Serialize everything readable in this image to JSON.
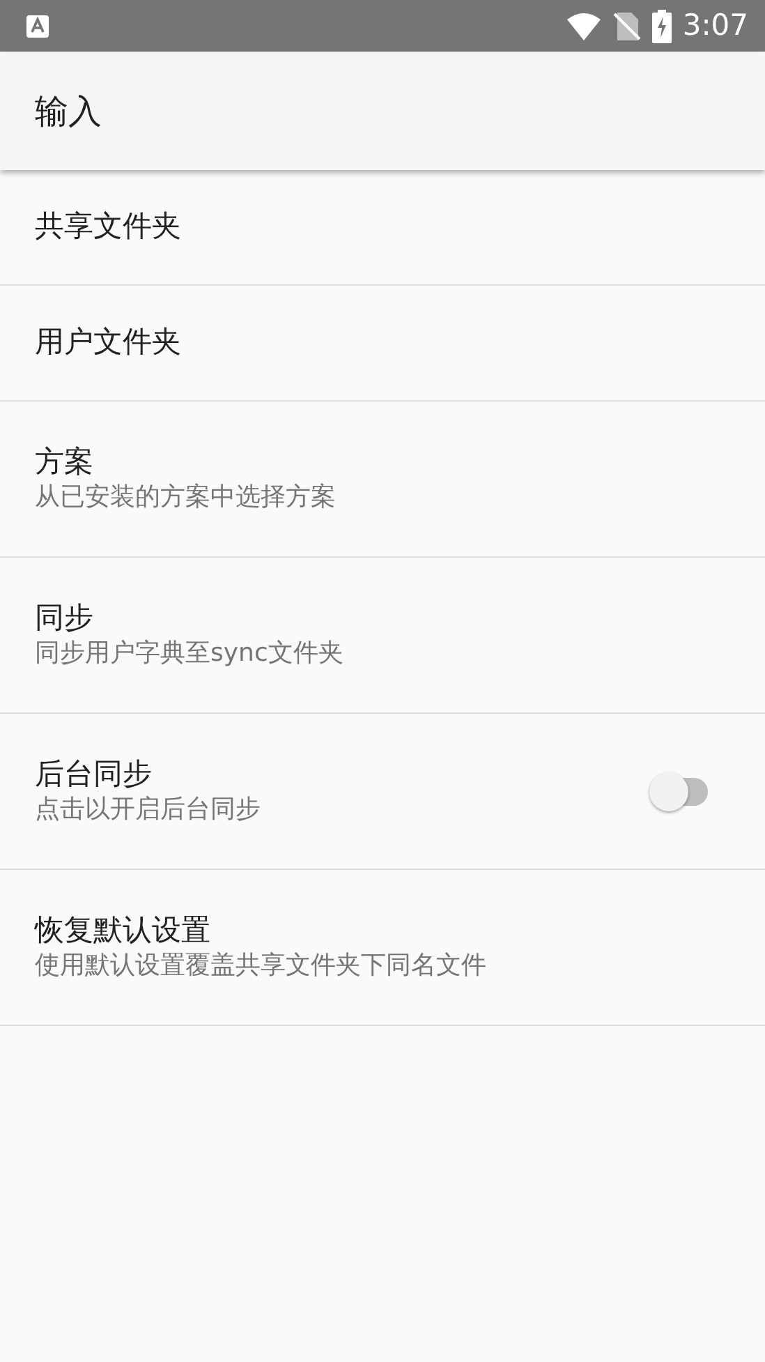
{
  "status_bar": {
    "time": "3:07"
  },
  "toolbar": {
    "title": "输入"
  },
  "items": [
    {
      "kind": "plain",
      "title": "共享文件夹"
    },
    {
      "kind": "plain",
      "title": "用户文件夹"
    },
    {
      "kind": "plain",
      "title": "方案",
      "summary": "从已安装的方案中选择方案"
    },
    {
      "kind": "plain",
      "title": "同步",
      "summary": "同步用户字典至sync文件夹"
    },
    {
      "kind": "switch",
      "title": "后台同步",
      "summary": "点击以开启后台同步",
      "on": false
    },
    {
      "kind": "plain",
      "title": "恢复默认设置",
      "summary": "使用默认设置覆盖共享文件夹下同名文件"
    }
  ]
}
